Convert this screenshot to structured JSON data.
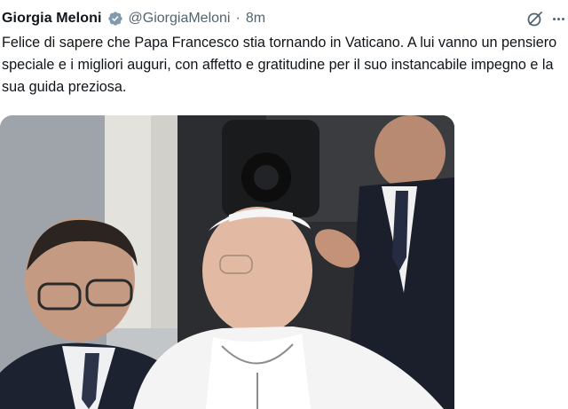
{
  "tweet": {
    "author_name": "Giorgia Meloni",
    "handle": "@GiorgiaMeloni",
    "separator": "·",
    "time": "8m",
    "text": "Felice di sapere che Papa Francesco stia tornando in Vaticano. A lui vanno un pensiero speciale e i migliori auguri, con affetto e gratitudine per il suo instancabile impegno e la sua guida preziosa."
  },
  "icons": {
    "verified": "verified-badge-icon",
    "grok": "grok-icon",
    "more": "more-options-icon"
  },
  "colors": {
    "text": "#0f1419",
    "secondary": "#536471",
    "verified_badge": "#829aab"
  }
}
